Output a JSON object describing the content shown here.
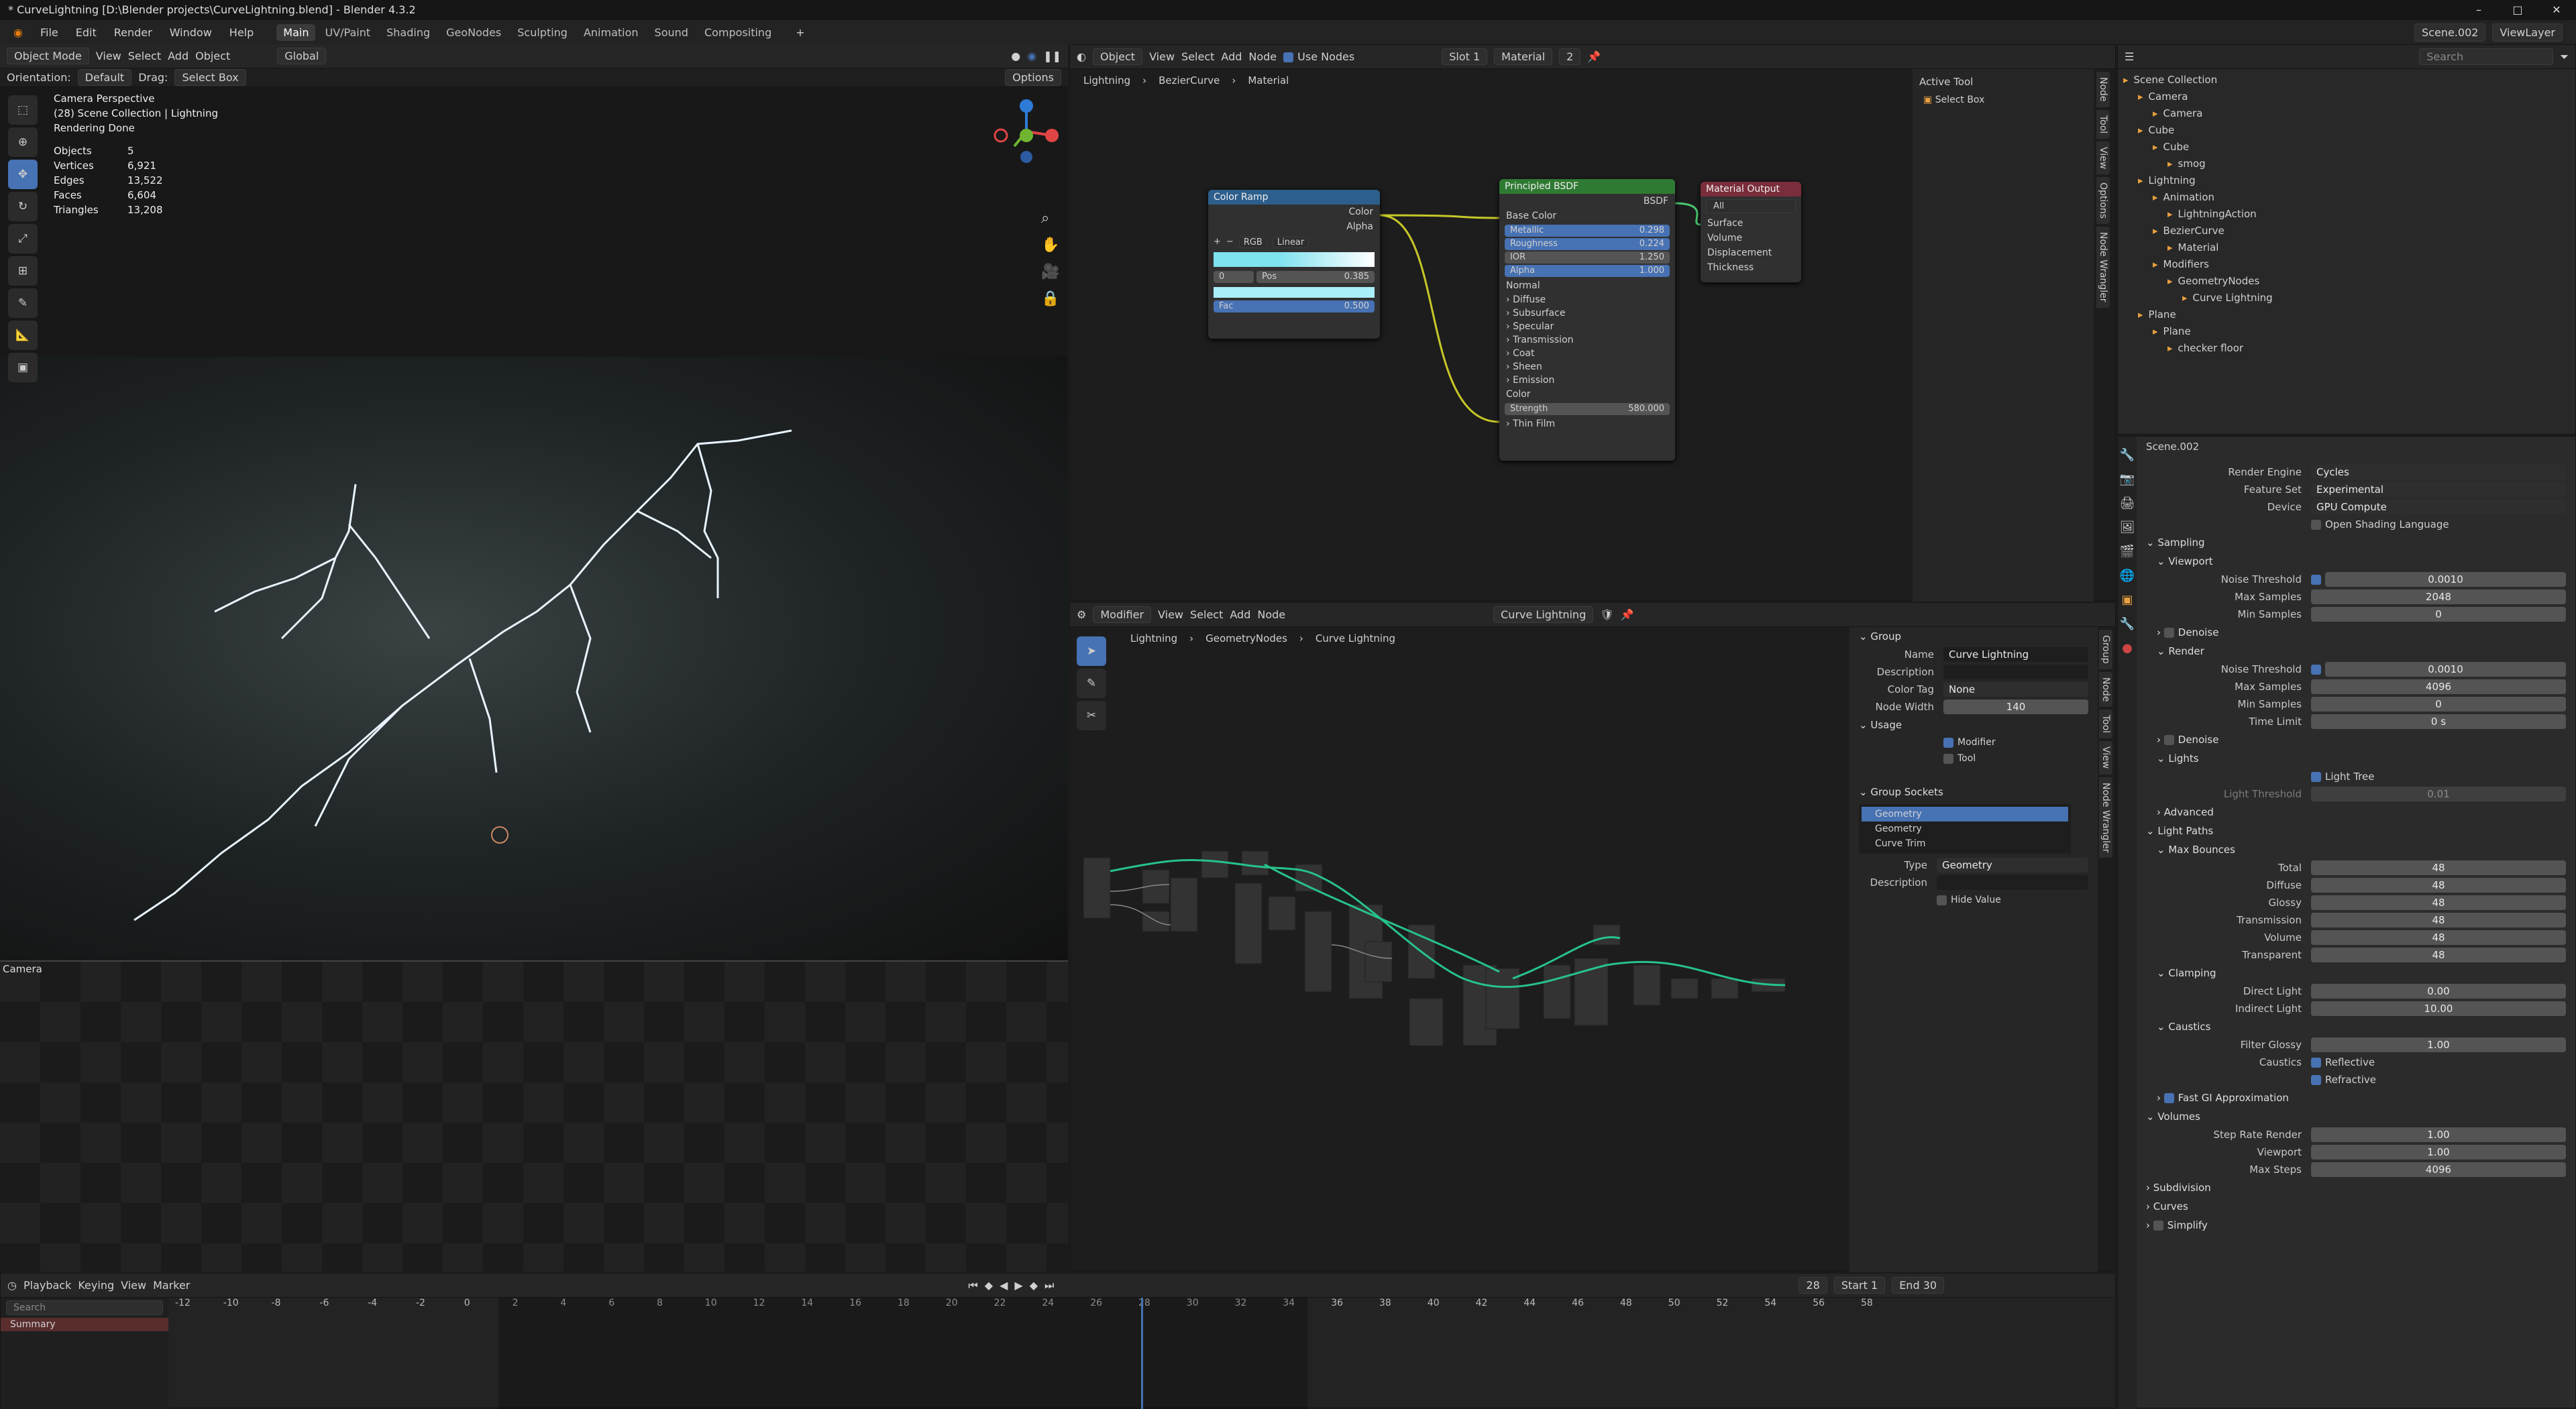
{
  "window": {
    "title": "* CurveLightning [D:\\Blender projects\\CurveLightning.blend] - Blender 4.3.2"
  },
  "menu": {
    "file": "File",
    "edit": "Edit",
    "render": "Render",
    "window": "Window",
    "help": "Help"
  },
  "workspaces": [
    "Main",
    "UV/Paint",
    "Shading",
    "GeoNodes",
    "Sculpting",
    "Animation",
    "Sound",
    "Compositing"
  ],
  "topright": {
    "scene": "Scene.002",
    "viewlayer": "ViewLayer"
  },
  "viewport": {
    "mode": "Object Mode",
    "menus": [
      "View",
      "Select",
      "Add",
      "Object"
    ],
    "transform": "Global",
    "orientation_label": "Orientation:",
    "orientation": "Default",
    "drag_label": "Drag:",
    "drag": "Select Box",
    "options": "Options",
    "info_line1": "Camera Perspective",
    "info_line2": "(28) Scene Collection | Lightning",
    "info_line3": "Rendering Done",
    "stats": [
      {
        "k": "Objects",
        "v": "5"
      },
      {
        "k": "Vertices",
        "v": "6,921"
      },
      {
        "k": "Edges",
        "v": "13,522"
      },
      {
        "k": "Faces",
        "v": "6,604"
      },
      {
        "k": "Triangles",
        "v": "13,208"
      }
    ],
    "camera_label": "Camera"
  },
  "shader": {
    "object": "Object",
    "menus": [
      "View",
      "Select",
      "Add",
      "Node"
    ],
    "use_nodes": "Use Nodes",
    "slot": "Slot 1",
    "material": "Material",
    "users": "2",
    "breadcrumb": [
      "Lightning",
      "BezierCurve",
      "Material"
    ],
    "colorramp": {
      "title": "Color Ramp",
      "out_color": "Color",
      "out_alpha": "Alpha",
      "mode": "RGB",
      "interp": "Linear",
      "index": "0",
      "pos_label": "Pos",
      "pos": "0.385",
      "fac_label": "Fac",
      "fac": "0.500"
    },
    "bsdf": {
      "title": "Principled BSDF",
      "out": "BSDF",
      "base_color": "Base Color",
      "metallic": "Metallic",
      "metallic_v": "0.298",
      "roughness": "Roughness",
      "roughness_v": "0.224",
      "ior": "IOR",
      "ior_v": "1.250",
      "alpha": "Alpha",
      "alpha_v": "1.000",
      "normal": "Normal",
      "panels": [
        "Diffuse",
        "Subsurface",
        "Specular",
        "Transmission",
        "Coat",
        "Sheen",
        "Emission"
      ],
      "color": "Color",
      "strength": "Strength",
      "strength_v": "580.000",
      "thin": "Thin Film"
    },
    "output": {
      "title": "Material Output",
      "target": "All",
      "sockets": [
        "Surface",
        "Volume",
        "Displacement",
        "Thickness"
      ]
    },
    "sidebar": {
      "title": "Active Tool",
      "tool": "Select Box"
    },
    "vtabs": [
      "Node",
      "Tool",
      "View",
      "Options",
      "Node Wrangler"
    ]
  },
  "geo": {
    "mode": "Modifier",
    "menus": [
      "View",
      "Select",
      "Add",
      "Node"
    ],
    "tree": "Curve Lightning",
    "breadcrumb": [
      "Lightning",
      "GeometryNodes",
      "Curve Lightning"
    ],
    "group": {
      "section": "Group",
      "name_label": "Name",
      "name": "Curve Lightning",
      "desc_label": "Description",
      "colortag_label": "Color Tag",
      "colortag": "None",
      "width_label": "Node Width",
      "width": "140",
      "usage": "Usage",
      "modifier": "Modifier",
      "tool": "Tool"
    },
    "sockets": {
      "section": "Group Sockets",
      "items": [
        "Geometry",
        "Geometry",
        "Curve Trim"
      ],
      "type_label": "Type",
      "type": "Geometry",
      "desc_label": "Description",
      "hide": "Hide Value"
    },
    "vtabs": [
      "Group",
      "Node",
      "Tool",
      "View",
      "Node Wrangler"
    ]
  },
  "outliner": {
    "search": "Search",
    "rows": [
      {
        "t": "Scene Collection",
        "d": 0
      },
      {
        "t": "Camera",
        "d": 1
      },
      {
        "t": "Camera",
        "d": 2
      },
      {
        "t": "Cube",
        "d": 1
      },
      {
        "t": "Cube",
        "d": 2
      },
      {
        "t": "smog",
        "d": 3
      },
      {
        "t": "Lightning",
        "d": 1
      },
      {
        "t": "Animation",
        "d": 2
      },
      {
        "t": "LightningAction",
        "d": 3
      },
      {
        "t": "BezierCurve",
        "d": 2
      },
      {
        "t": "Material",
        "d": 3
      },
      {
        "t": "Modifiers",
        "d": 2
      },
      {
        "t": "GeometryNodes",
        "d": 3
      },
      {
        "t": "Curve Lightning",
        "d": 4
      },
      {
        "t": "Plane",
        "d": 1
      },
      {
        "t": "Plane",
        "d": 2
      },
      {
        "t": "checker floor",
        "d": 3
      }
    ]
  },
  "props": {
    "scene": "Scene.002",
    "engine_label": "Render Engine",
    "engine": "Cycles",
    "feature_label": "Feature Set",
    "feature": "Experimental",
    "device_label": "Device",
    "device": "GPU Compute",
    "osl": "Open Shading Language",
    "sampling": "Sampling",
    "viewport": "Viewport",
    "noise": "Noise Threshold",
    "v_noise": "0.0010",
    "maxs": "Max Samples",
    "v_max": "2048",
    "mins": "Min Samples",
    "v_min": "0",
    "denoise": "Denoise",
    "render": "Render",
    "r_noise": "0.0010",
    "r_max": "4096",
    "r_min": "0",
    "time": "Time Limit",
    "r_time": "0 s",
    "lights": "Lights",
    "tree": "Light Tree",
    "thresh": "Light Threshold",
    "thresh_v": "0.01",
    "advanced": "Advanced",
    "paths": "Light Paths",
    "bounces": "Max Bounces",
    "bounce_rows": [
      {
        "k": "Total",
        "v": "48"
      },
      {
        "k": "Diffuse",
        "v": "48"
      },
      {
        "k": "Glossy",
        "v": "48"
      },
      {
        "k": "Transmission",
        "v": "48"
      },
      {
        "k": "Volume",
        "v": "48"
      },
      {
        "k": "Transparent",
        "v": "48"
      }
    ],
    "clamping": "Clamping",
    "direct": "Direct Light",
    "direct_v": "0.00",
    "indirect": "Indirect Light",
    "indirect_v": "10.00",
    "caustics": "Caustics",
    "filter": "Filter Glossy",
    "filter_v": "1.00",
    "caustics_l": "Caustics",
    "reflective": "Reflective",
    "refractive": "Refractive",
    "fastgi": "Fast GI Approximation",
    "volumes": "Volumes",
    "step": "Step Rate Render",
    "step_v": "1.00",
    "viewport_l": "Viewport",
    "viewport_v": "1.00",
    "maxsteps": "Max Steps",
    "maxsteps_v": "4096",
    "subdivision": "Subdivision",
    "curves": "Curves",
    "simplify": "Simplify"
  },
  "timeline": {
    "menus": [
      "Playback",
      "Keying",
      "View",
      "Marker"
    ],
    "frame": "28",
    "start_label": "Start",
    "start": "1",
    "end_label": "End",
    "end": "30",
    "search": "Search",
    "summary": "Summary",
    "ticks": [
      "-12",
      "-10",
      "-8",
      "-6",
      "-4",
      "-2",
      "0",
      "2",
      "4",
      "6",
      "8",
      "10",
      "12",
      "14",
      "16",
      "18",
      "20",
      "22",
      "24",
      "26",
      "28",
      "30",
      "32",
      "34",
      "36",
      "38",
      "40",
      "42",
      "44",
      "46",
      "48",
      "50",
      "52",
      "54",
      "56",
      "58"
    ]
  }
}
